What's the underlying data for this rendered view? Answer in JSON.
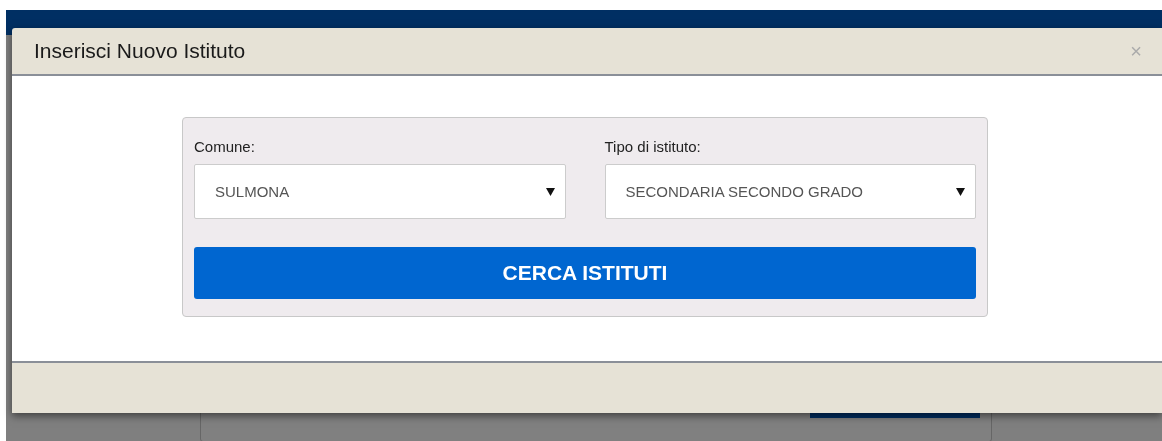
{
  "modal": {
    "title": "Inserisci Nuovo Istituto",
    "close": "×"
  },
  "form": {
    "fields": [
      {
        "label": "Comune:",
        "value": "SULMONA"
      },
      {
        "label": "Tipo di istituto:",
        "value": "SECONDARIA SECONDO GRADO"
      }
    ],
    "button": "CERCA ISTITUTI"
  }
}
